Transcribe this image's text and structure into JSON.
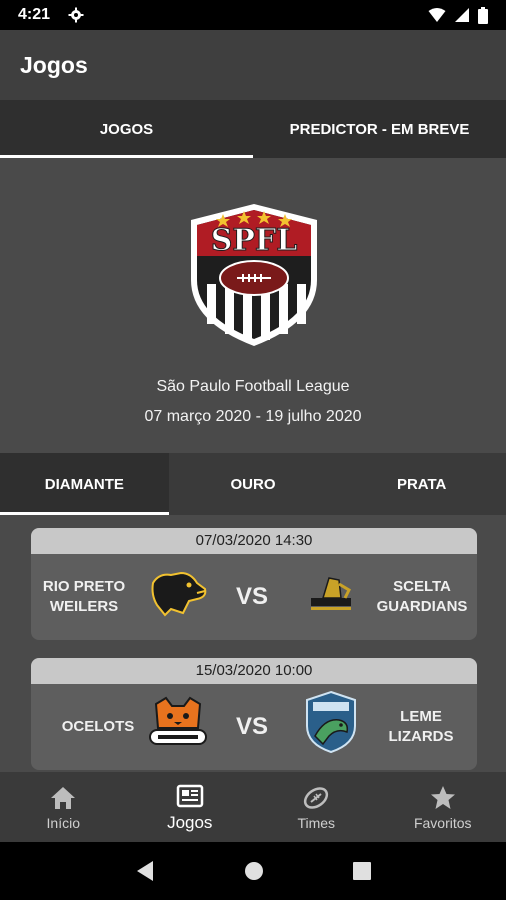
{
  "status_bar": {
    "time": "4:21"
  },
  "app_bar": {
    "title": "Jogos"
  },
  "top_tabs": [
    {
      "label": "JOGOS",
      "active": true
    },
    {
      "label": "PREDICTOR - EM BREVE",
      "active": false
    }
  ],
  "league": {
    "logo_text": "SPFL",
    "name": "São Paulo Football League",
    "dates": "07 março 2020 - 19 julho 2020"
  },
  "division_tabs": [
    {
      "label": "DIAMANTE",
      "active": true
    },
    {
      "label": "OURO",
      "active": false
    },
    {
      "label": "PRATA",
      "active": false
    }
  ],
  "games": [
    {
      "date": "07/03/2020 14:30",
      "home": {
        "name_line1": "RIO PRETO",
        "name_line2": "WEILERS"
      },
      "vs": "VS",
      "away": {
        "name_line1": "SCELTA",
        "name_line2": "GUARDIANS"
      }
    },
    {
      "date": "15/03/2020 10:00",
      "home": {
        "name_line1": "OCELOTS",
        "name_line2": ""
      },
      "vs": "VS",
      "away": {
        "name_line1": "LEME",
        "name_line2": "LIZARDS"
      }
    }
  ],
  "bottom_nav": [
    {
      "label": "Início",
      "icon": "home-icon",
      "active": false
    },
    {
      "label": "Jogos",
      "icon": "newspaper-icon",
      "active": true
    },
    {
      "label": "Times",
      "icon": "football-icon",
      "active": false
    },
    {
      "label": "Favoritos",
      "icon": "star-icon",
      "active": false
    }
  ],
  "colors": {
    "logo_red": "#b01c24",
    "active_indicator": "#ffffff",
    "date_header": "#c8c8c8"
  }
}
